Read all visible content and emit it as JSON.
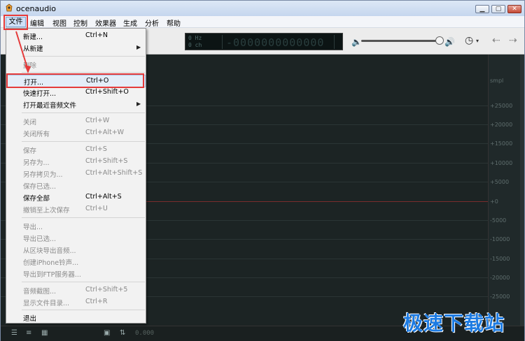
{
  "window": {
    "title": "ocenaudio"
  },
  "menubar": [
    "文件",
    "编辑",
    "视图",
    "控制",
    "效果器",
    "生成",
    "分析",
    "帮助"
  ],
  "lcd": {
    "freq": "0 Hz",
    "channels": "0 ch",
    "counter": "-0000000000000"
  },
  "ruler": {
    "unit": "smpl",
    "ticks": [
      "+25000",
      "+20000",
      "+15000",
      "+10000",
      "+5000",
      "+0",
      "-5000",
      "-10000",
      "-15000",
      "-20000",
      "-25000"
    ]
  },
  "status": {
    "time": "0.000"
  },
  "file_menu": {
    "items": [
      {
        "label": "新建...",
        "shortcut": "Ctrl+N",
        "disabled": false,
        "submenu": false
      },
      {
        "label": "从新建",
        "shortcut": "",
        "disabled": false,
        "submenu": true
      },
      {
        "label": "删除",
        "shortcut": "",
        "disabled": true,
        "submenu": false
      },
      {
        "label": "打开...",
        "shortcut": "Ctrl+O",
        "disabled": false,
        "submenu": false
      },
      {
        "label": "快速打开...",
        "shortcut": "Ctrl+Shift+O",
        "disabled": false,
        "submenu": false
      },
      {
        "label": "打开最近音频文件",
        "shortcut": "",
        "disabled": false,
        "submenu": true
      },
      {
        "label": "关闭",
        "shortcut": "Ctrl+W",
        "disabled": true,
        "submenu": false
      },
      {
        "label": "关闭所有",
        "shortcut": "Ctrl+Alt+W",
        "disabled": true,
        "submenu": false
      },
      {
        "label": "保存",
        "shortcut": "Ctrl+S",
        "disabled": true,
        "submenu": false
      },
      {
        "label": "另存为...",
        "shortcut": "Ctrl+Shift+S",
        "disabled": true,
        "submenu": false
      },
      {
        "label": "另存拷贝为...",
        "shortcut": "Ctrl+Alt+Shift+S",
        "disabled": true,
        "submenu": false
      },
      {
        "label": "保存已选...",
        "shortcut": "",
        "disabled": true,
        "submenu": false
      },
      {
        "label": "保存全部",
        "shortcut": "Ctrl+Alt+S",
        "disabled": false,
        "submenu": false
      },
      {
        "label": "撤销至上次保存",
        "shortcut": "Ctrl+U",
        "disabled": true,
        "submenu": false
      },
      {
        "label": "导出...",
        "shortcut": "",
        "disabled": true,
        "submenu": false
      },
      {
        "label": "导出已选...",
        "shortcut": "",
        "disabled": true,
        "submenu": false
      },
      {
        "label": "从区块导出音频...",
        "shortcut": "",
        "disabled": true,
        "submenu": false
      },
      {
        "label": "创建iPhone铃声...",
        "shortcut": "",
        "disabled": true,
        "submenu": false
      },
      {
        "label": "导出到FTP服务器...",
        "shortcut": "",
        "disabled": true,
        "submenu": false
      },
      {
        "label": "音频截图...",
        "shortcut": "Ctrl+Shift+5",
        "disabled": true,
        "submenu": false
      },
      {
        "label": "显示文件目录...",
        "shortcut": "Ctrl+R",
        "disabled": true,
        "submenu": false
      },
      {
        "label": "退出",
        "shortcut": "",
        "disabled": false,
        "submenu": false
      }
    ]
  },
  "watermark": "极速下载站",
  "colors": {
    "highlight": "#e53a3a",
    "watermark": "#1d7be2"
  }
}
